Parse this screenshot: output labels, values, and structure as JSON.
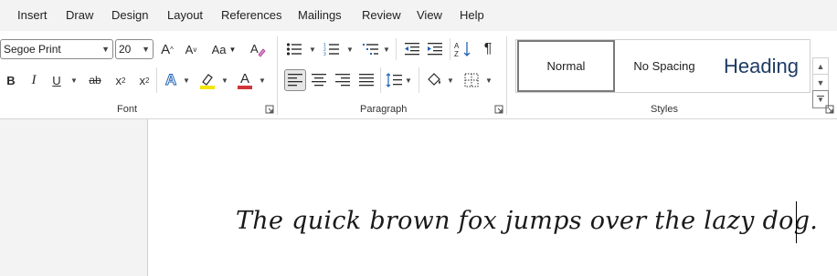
{
  "menu": {
    "tabs": [
      "Insert",
      "Draw",
      "Design",
      "Layout",
      "References",
      "Mailings",
      "Review",
      "View",
      "Help"
    ]
  },
  "ribbon": {
    "font": {
      "group_label": "Font",
      "font_name": "Segoe Print",
      "font_size": "20",
      "grow_label": "A",
      "shrink_label": "A",
      "change_case_label": "Aa",
      "bold_label": "B",
      "italic_label": "I",
      "underline_label": "U",
      "strike_label": "ab",
      "subscript_label": "x",
      "subscript_mark": "2",
      "superscript_label": "x",
      "superscript_mark": "2",
      "text_effects_label": "A",
      "font_color_label": "A",
      "highlight_color": "#f5e400",
      "font_color": "#d13438"
    },
    "paragraph": {
      "group_label": "Paragraph",
      "pilcrow": "¶"
    },
    "styles": {
      "group_label": "Styles",
      "items": [
        "Normal",
        "No Spacing",
        "Heading"
      ],
      "heading_color": "#1f3b63"
    }
  },
  "document": {
    "text": "The quick brown fox jumps over the lazy dog."
  }
}
